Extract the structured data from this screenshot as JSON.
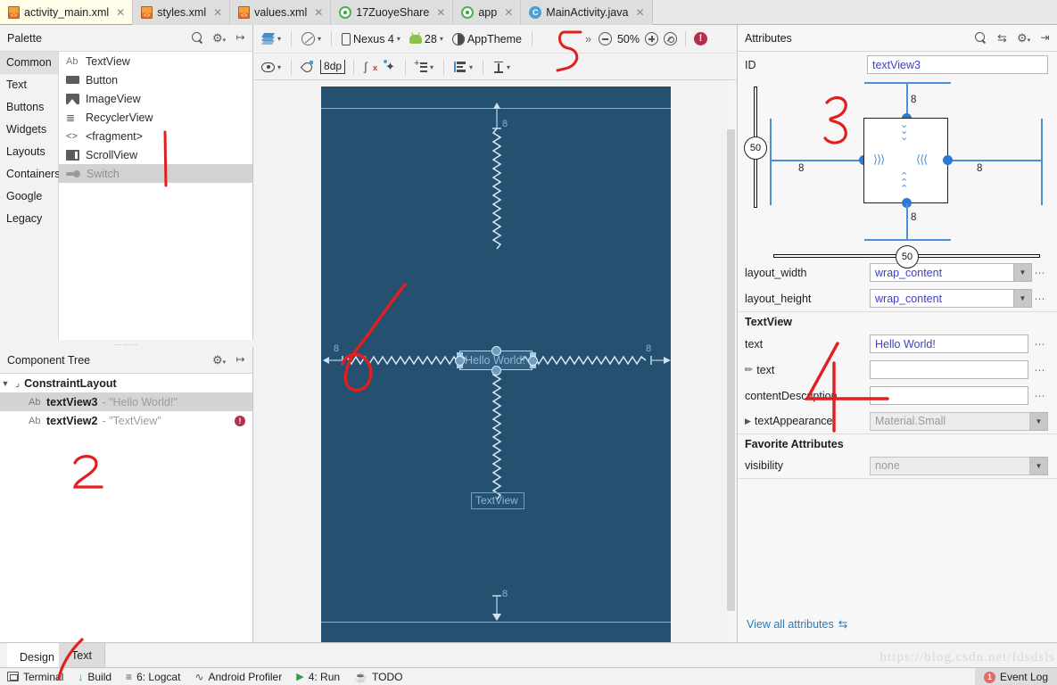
{
  "tabs": [
    {
      "label": "activity_main.xml",
      "icon": "xml-file-icon",
      "active": true
    },
    {
      "label": "styles.xml",
      "icon": "xml-file-icon",
      "active": false
    },
    {
      "label": "values.xml",
      "icon": "xml-file-icon",
      "active": false
    },
    {
      "label": "17ZuoyeShare",
      "icon": "android-module-icon",
      "active": false
    },
    {
      "label": "app",
      "icon": "android-module-icon",
      "active": false
    },
    {
      "label": "MainActivity.java",
      "icon": "java-class-icon",
      "active": false
    }
  ],
  "palette": {
    "title": "Palette",
    "categories": [
      {
        "label": "Common",
        "selected": true
      },
      {
        "label": "Text",
        "selected": false
      },
      {
        "label": "Buttons",
        "selected": false
      },
      {
        "label": "Widgets",
        "selected": false
      },
      {
        "label": "Layouts",
        "selected": false
      },
      {
        "label": "Containers",
        "selected": false
      },
      {
        "label": "Google",
        "selected": false
      },
      {
        "label": "Legacy",
        "selected": false
      }
    ],
    "items": [
      {
        "label": "TextView",
        "icon": "textview-icon",
        "selected": false
      },
      {
        "label": "Button",
        "icon": "button-icon",
        "selected": false
      },
      {
        "label": "ImageView",
        "icon": "imageview-icon",
        "selected": false
      },
      {
        "label": "RecyclerView",
        "icon": "recyclerview-icon",
        "selected": false
      },
      {
        "label": "<fragment>",
        "icon": "fragment-icon",
        "selected": false
      },
      {
        "label": "ScrollView",
        "icon": "scrollview-icon",
        "selected": false
      },
      {
        "label": "Switch",
        "icon": "switch-icon",
        "selected": true
      }
    ]
  },
  "component_tree": {
    "title": "Component Tree",
    "rows": [
      {
        "name": "ConstraintLayout",
        "value": "",
        "icon": "constraintlayout-icon",
        "selected": false,
        "error": false,
        "depth": 0
      },
      {
        "name": "textView3",
        "value": "- \"Hello World!\"",
        "icon": "textview-icon",
        "selected": true,
        "error": false,
        "depth": 1
      },
      {
        "name": "textView2",
        "value": "- \"TextView\"",
        "icon": "textview-icon",
        "selected": false,
        "error": true,
        "depth": 1
      }
    ]
  },
  "design_toolbar": {
    "layout_variants_label": "",
    "orientation_label": "",
    "device": "Nexus 4",
    "api_level": "28",
    "theme": "AppTheme",
    "overflow": "»",
    "zoom_level": "50%",
    "default_margin": "8dp",
    "error_count": "!"
  },
  "canvas": {
    "selected_widget_text": "Hello World!",
    "other_widget_text": "TextView",
    "margins": {
      "top": "8",
      "left": "8",
      "right": "8",
      "bottom": "8"
    }
  },
  "attributes": {
    "title": "Attributes",
    "id_label": "ID",
    "id_value": "textView3",
    "constraint_widget": {
      "top_margin": "8",
      "left_margin": "8",
      "right_margin": "8",
      "bottom_margin": "8",
      "vertical_bias": "50",
      "horizontal_bias": "50"
    },
    "rows": [
      {
        "label": "layout_width",
        "value": "wrap_content",
        "type": "dropdown",
        "dots": true,
        "disabled": false
      },
      {
        "label": "layout_height",
        "value": "wrap_content",
        "type": "dropdown",
        "dots": true,
        "disabled": false
      }
    ],
    "textview_section": {
      "header": "TextView",
      "rows": [
        {
          "label": "text",
          "value": "Hello World!",
          "type": "text",
          "dots": true,
          "icon": "",
          "disabled": false
        },
        {
          "label": "text",
          "value": "",
          "type": "text",
          "dots": true,
          "icon": "design-text-icon",
          "disabled": false
        },
        {
          "label": "contentDescription",
          "value": "",
          "type": "text",
          "dots": true,
          "icon": "",
          "disabled": false
        },
        {
          "label": "textAppearance",
          "value": "Material.Small",
          "type": "dropdown",
          "dots": false,
          "icon": "expand-icon",
          "disabled": true
        }
      ]
    },
    "favorites_section": {
      "header": "Favorite Attributes",
      "rows": [
        {
          "label": "visibility",
          "value": "none",
          "type": "dropdown",
          "dots": false,
          "disabled": true
        }
      ]
    },
    "view_all_label": "View all attributes"
  },
  "bottom": {
    "editor_tabs": [
      {
        "label": "Design",
        "active": true
      },
      {
        "label": "Text",
        "active": false
      }
    ],
    "status_items": [
      {
        "label": "Terminal",
        "icon": "terminal-icon",
        "mnemonic": ""
      },
      {
        "label": "Build",
        "icon": "build-icon",
        "mnemonic": ""
      },
      {
        "label": "6: Logcat",
        "icon": "logcat-icon",
        "mnemonic": "6"
      },
      {
        "label": "Android Profiler",
        "icon": "profiler-icon",
        "mnemonic": ""
      },
      {
        "label": "4: Run",
        "icon": "run-icon",
        "mnemonic": "4"
      },
      {
        "label": "TODO",
        "icon": "todo-icon",
        "mnemonic": ""
      }
    ],
    "event_log": {
      "label": "Event Log",
      "badge": "1"
    },
    "watermark": "https://blog.csdn.net/fdsdsls"
  },
  "annotations": {
    "marks": [
      "1",
      "2",
      "3",
      "4",
      "5",
      "6",
      "7"
    ],
    "color": "#e02020"
  },
  "colors": {
    "accent_blue": "#4a90d9",
    "blueprint_bg": "#26506f",
    "blueprint_line": "#7fb2d9",
    "link": "#2a7ab8",
    "error": "#b3304a",
    "value_text": "#3f3fbf"
  }
}
